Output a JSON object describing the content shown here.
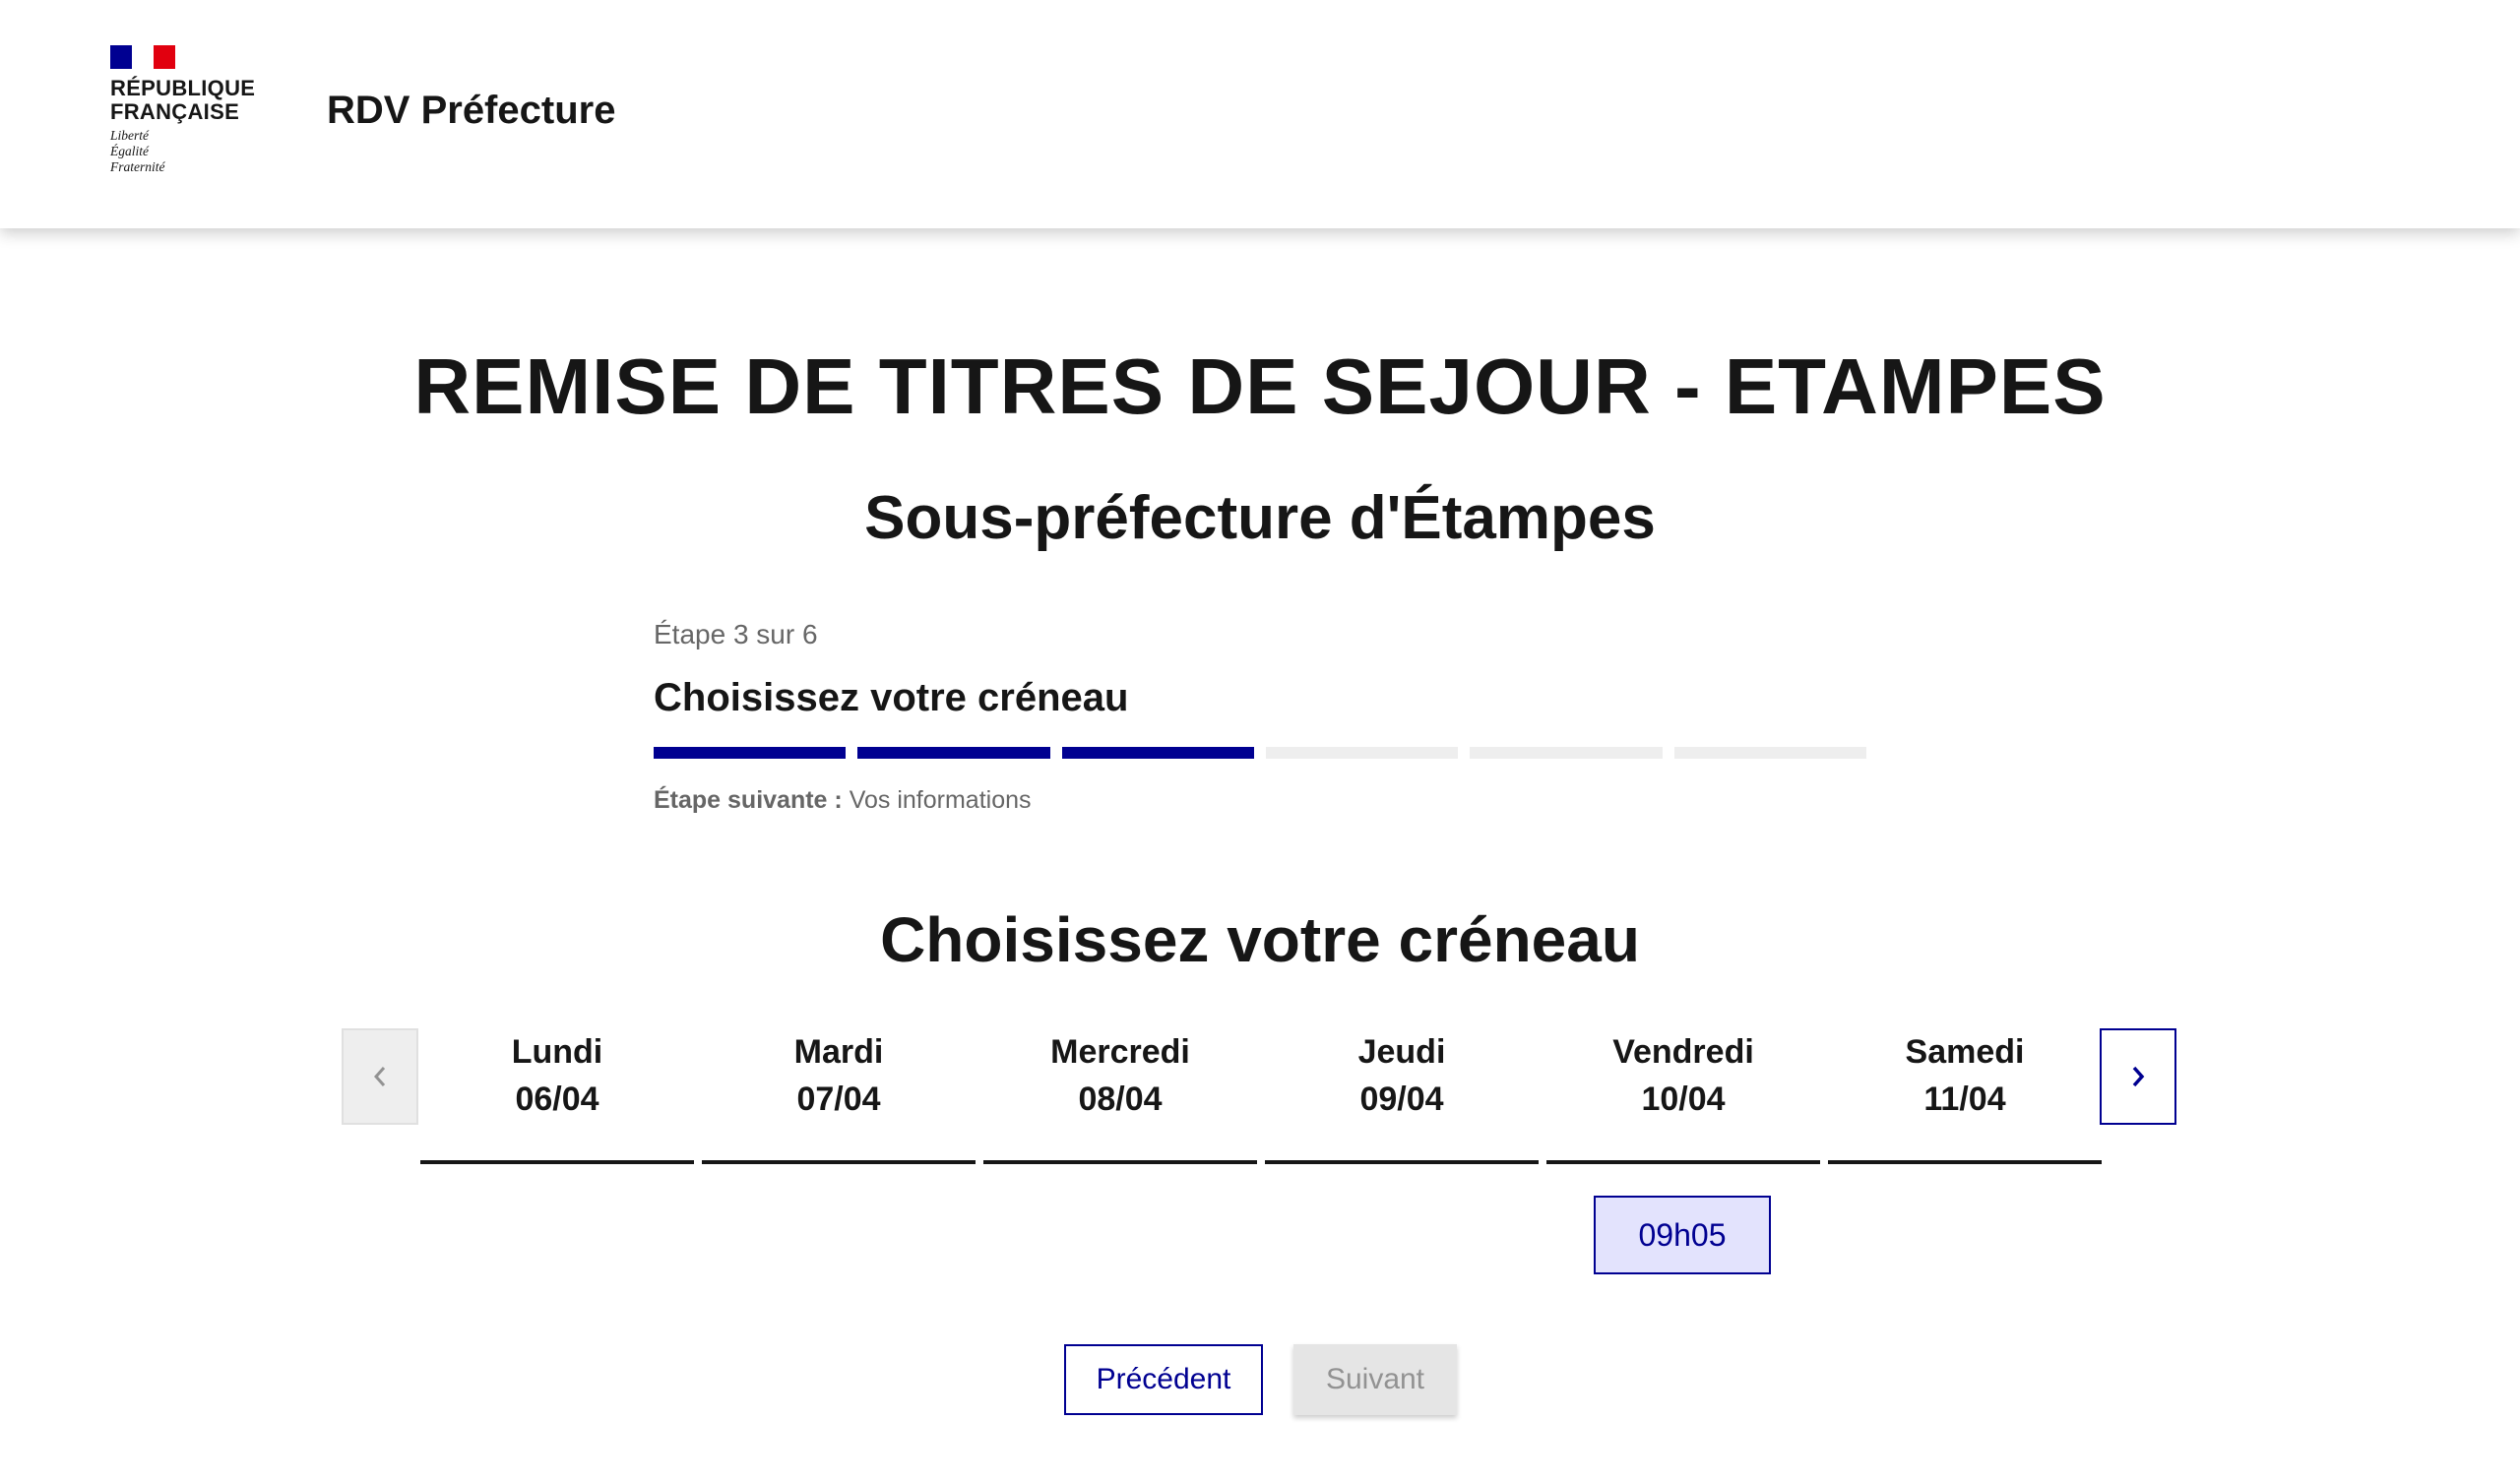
{
  "header": {
    "logo_line1": "RÉPUBLIQUE",
    "logo_line2": "FRANÇAISE",
    "motto_1": "Liberté",
    "motto_2": "Égalité",
    "motto_3": "Fraternité",
    "service_title": "RDV Préfecture",
    "flag_colors": [
      "#000091",
      "#ffffff",
      "#e1000f"
    ]
  },
  "main": {
    "title": "REMISE DE TITRES DE SEJOUR - ETAMPES",
    "subtitle": "Sous-préfecture d'Étampes"
  },
  "stepper": {
    "state": "Étape 3 sur 6",
    "title": "Choisissez votre créneau",
    "current_step": 3,
    "total_steps": 6,
    "next_label": "Étape suivante :",
    "next_value": "Vos informations"
  },
  "slots_section": {
    "title": "Choisissez votre créneau",
    "prev_icon": "chevron-left-icon",
    "next_icon": "chevron-right-icon",
    "days": [
      {
        "name": "Lundi",
        "date": "06/04"
      },
      {
        "name": "Mardi",
        "date": "07/04"
      },
      {
        "name": "Mercredi",
        "date": "08/04"
      },
      {
        "name": "Jeudi",
        "date": "09/04"
      },
      {
        "name": "Vendredi",
        "date": "10/04"
      },
      {
        "name": "Samedi",
        "date": "11/04"
      }
    ],
    "slot": {
      "day": "Vendredi",
      "time": "09h05"
    }
  },
  "actions": {
    "prev_label": "Précédent",
    "next_label": "Suivant"
  },
  "colors": {
    "primary": "#000091",
    "text": "#161616",
    "muted": "#666666",
    "slot_bg": "#e3e3fd",
    "disabled_bg": "#e5e5e5"
  }
}
